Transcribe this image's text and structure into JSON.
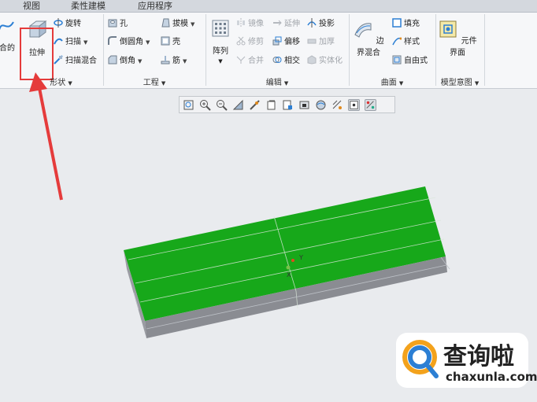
{
  "tabs": [
    "视图",
    "柔性建模",
    "应用程序"
  ],
  "ribbon": {
    "shape_group": {
      "label": "形状",
      "partial_left_label": "扫描混合的",
      "extrude_label": "拉伸",
      "revolve_label": "旋转",
      "sweep_label": "扫描",
      "swept_blend_label": "扫描混合"
    },
    "engineering_group": {
      "label": "工程",
      "hole_label": "孔",
      "round_label": "倒圆角",
      "chamfer_label": "倒角",
      "draft_label": "拔模",
      "shell_label": "壳",
      "rib_label": "筋"
    },
    "edit_group": {
      "label": "编辑",
      "pattern_label": "阵列",
      "mirror_label": "镜像",
      "extend_label": "延伸",
      "project_label": "投影",
      "trim_label": "修剪",
      "offset_label": "偏移",
      "thicken_label": "加厚",
      "merge_label": "合并",
      "intersect_label": "相交",
      "solidify_label": "实体化"
    },
    "surface_group": {
      "label": "曲面",
      "boundary_blend_label": "边界混合",
      "fill_label": "填充",
      "style_label": "样式",
      "freestyle_label": "自由式"
    },
    "model_intent_group": {
      "label": "模型意图",
      "component_interface_label": "元件界面"
    }
  },
  "model": {
    "top_face_color": "#17a81a",
    "side_face_color": "#8a8c92",
    "csys_label": "Y",
    "csys_label_2": "X"
  },
  "watermark": {
    "cn_text": "查询啦",
    "en_text": "chaxunla.com"
  },
  "colors": {
    "highlight_red": "#e53b3b",
    "ribbon_bg": "#f6f7f9",
    "viewport_bg": "#e9ebee"
  }
}
